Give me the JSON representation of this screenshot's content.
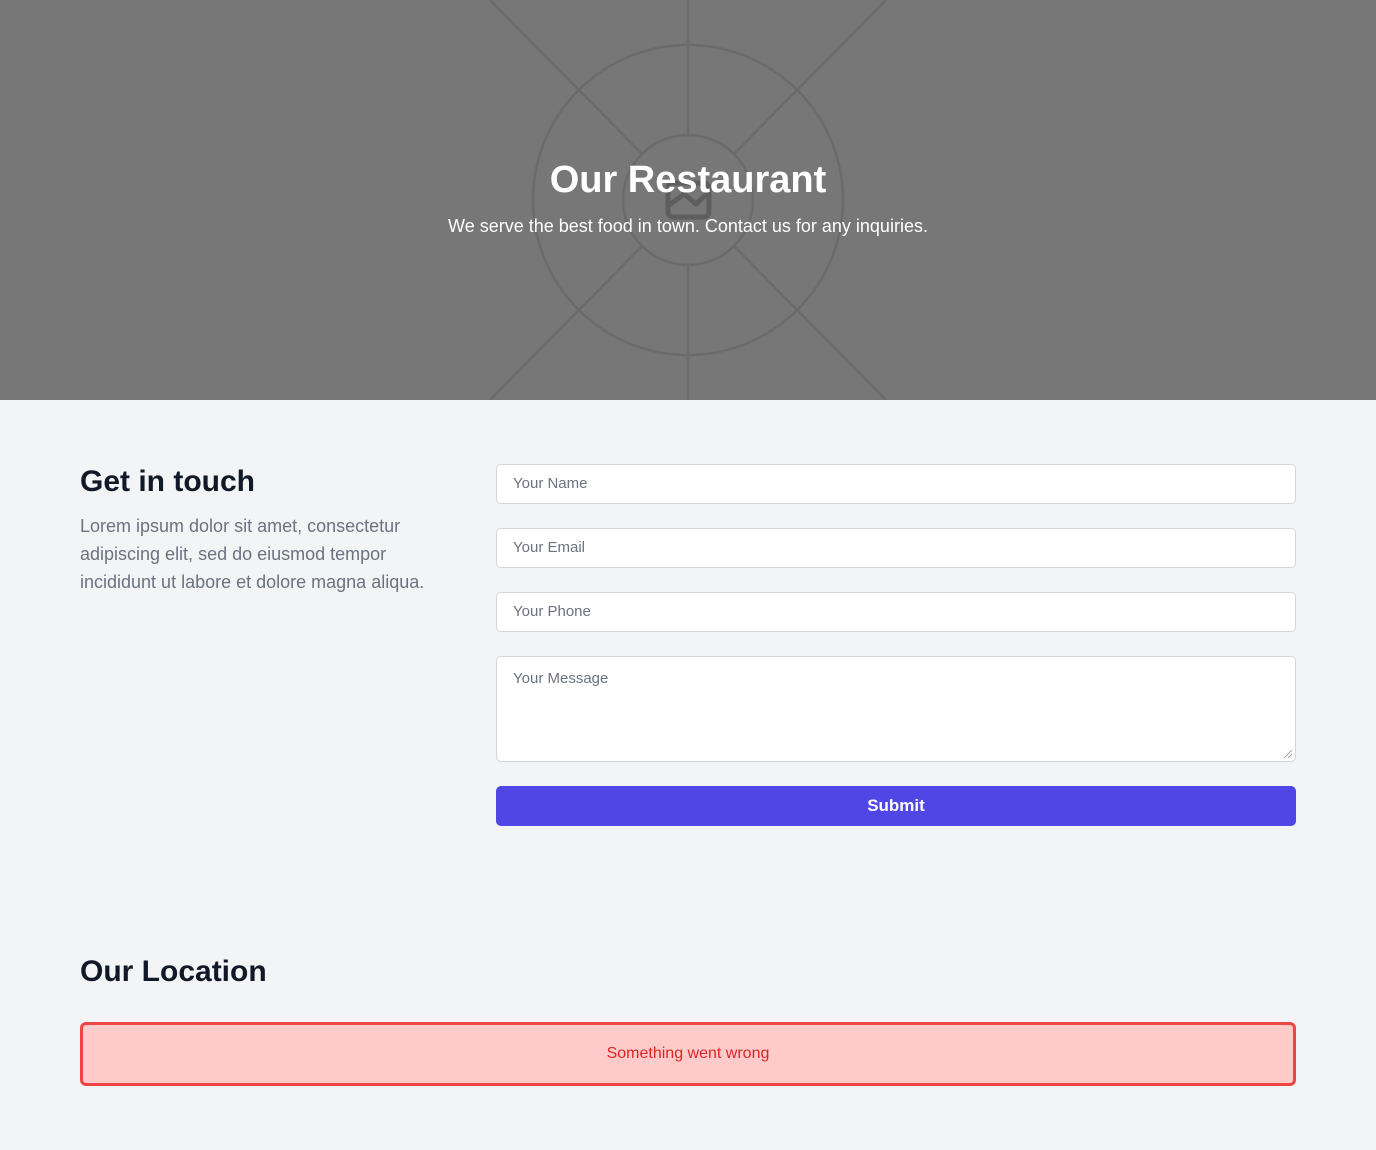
{
  "hero": {
    "title": "Our Restaurant",
    "subtitle": "We serve the best food in town. Contact us for any inquiries.",
    "background_color": "#777777",
    "image_icon": "image-placeholder-icon"
  },
  "contact": {
    "heading": "Get in touch",
    "description": "Lorem ipsum dolor sit amet, consectetur adipiscing elit, sed do eiusmod tempor incididunt ut labore et dolore magna aliqua.",
    "form": {
      "name_placeholder": "Your Name",
      "email_placeholder": "Your Email",
      "phone_placeholder": "Your Phone",
      "message_placeholder": "Your Message",
      "submit_label": "Submit"
    }
  },
  "location": {
    "heading": "Our Location",
    "error_message": "Something went wrong"
  },
  "colors": {
    "page_background": "#f3f4f6",
    "accent": "#4f46e5",
    "error_border": "#ef4444",
    "error_background": "#fecaca",
    "error_text": "#dc2626"
  }
}
